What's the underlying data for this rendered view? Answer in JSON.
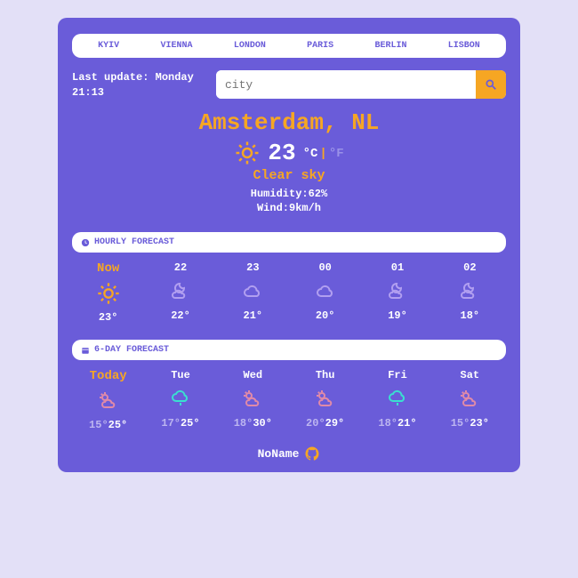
{
  "cities": [
    "KYIV",
    "VIENNA",
    "LONDON",
    "PARIS",
    "BERLIN",
    "LISBON"
  ],
  "last_update_label": "Last update: Monday 21:13",
  "search": {
    "placeholder": "city"
  },
  "location": "Amsterdam, NL",
  "current": {
    "temp": "23",
    "unit_c": "°C",
    "sep": "|",
    "unit_f": "°F",
    "description": "Clear sky",
    "humidity": "Humidity:62%",
    "wind": "Wind:9km/h"
  },
  "sections": {
    "hourly": "HOURLY FORECAST",
    "daily": "6-DAY FORECAST"
  },
  "hourly": [
    {
      "label": "Now",
      "temp": "23°",
      "icon": "sun",
      "highlight": true
    },
    {
      "label": "22",
      "temp": "22°",
      "icon": "moon-cloud"
    },
    {
      "label": "23",
      "temp": "21°",
      "icon": "cloud"
    },
    {
      "label": "00",
      "temp": "20°",
      "icon": "cloud"
    },
    {
      "label": "01",
      "temp": "19°",
      "icon": "moon-cloud"
    },
    {
      "label": "02",
      "temp": "18°",
      "icon": "moon-cloud"
    }
  ],
  "daily": [
    {
      "label": "Today",
      "min": "15°",
      "max": "25°",
      "icon": "sun-cloud",
      "highlight": true
    },
    {
      "label": "Tue",
      "min": "17°",
      "max": "25°",
      "icon": "rain"
    },
    {
      "label": "Wed",
      "min": "18°",
      "max": "30°",
      "icon": "sun-cloud"
    },
    {
      "label": "Thu",
      "min": "20°",
      "max": "29°",
      "icon": "sun-cloud"
    },
    {
      "label": "Fri",
      "min": "18°",
      "max": "21°",
      "icon": "rain"
    },
    {
      "label": "Sat",
      "min": "15°",
      "max": "23°",
      "icon": "sun-cloud"
    }
  ],
  "footer": {
    "author": "NoName"
  }
}
